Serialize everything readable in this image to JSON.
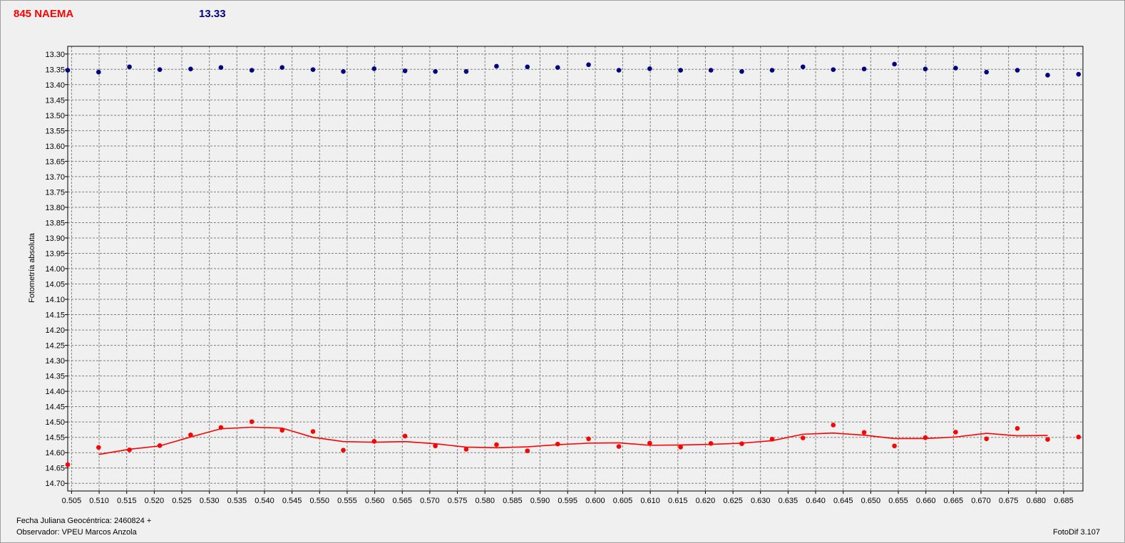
{
  "header": {
    "object_name": "845 NAEMA",
    "comparison_magnitude": "13.33"
  },
  "footer": {
    "date_label": "Fecha Juliana Geocéntrica: 2460824 +",
    "observer_label": "Observador: VPEU Marcos Anzola",
    "version_label": "FotoDif 3.107"
  },
  "colors": {
    "object": "#ff0000",
    "comparison": "#000080",
    "grid": "#808080"
  },
  "chart_data": {
    "type": "scatter",
    "ylabel": "Fotometría absoluta",
    "xlabel": "",
    "xlim": [
      0.5043,
      0.6885
    ],
    "ylim": [
      14.725,
      13.275
    ],
    "y_inverted": true,
    "grid": true,
    "x_ticks": [
      0.505,
      0.51,
      0.515,
      0.52,
      0.525,
      0.53,
      0.535,
      0.54,
      0.545,
      0.55,
      0.555,
      0.56,
      0.565,
      0.57,
      0.575,
      0.58,
      0.585,
      0.59,
      0.595,
      0.6,
      0.605,
      0.61,
      0.615,
      0.62,
      0.625,
      0.63,
      0.635,
      0.64,
      0.645,
      0.65,
      0.655,
      0.66,
      0.665,
      0.67,
      0.675,
      0.68,
      0.685
    ],
    "y_ticks": [
      13.3,
      13.35,
      13.4,
      13.45,
      13.5,
      13.55,
      13.6,
      13.65,
      13.7,
      13.75,
      13.8,
      13.85,
      13.9,
      13.95,
      14.0,
      14.05,
      14.1,
      14.15,
      14.2,
      14.25,
      14.3,
      14.35,
      14.4,
      14.45,
      14.5,
      14.55,
      14.6,
      14.65,
      14.7
    ],
    "x": [
      0.5043,
      0.5099,
      0.5155,
      0.521,
      0.5266,
      0.5321,
      0.5377,
      0.5432,
      0.5488,
      0.5543,
      0.5599,
      0.5655,
      0.571,
      0.5766,
      0.5821,
      0.5877,
      0.5932,
      0.5988,
      0.6043,
      0.6099,
      0.6155,
      0.621,
      0.6266,
      0.6321,
      0.6377,
      0.6432,
      0.6488,
      0.6543,
      0.6599,
      0.6654,
      0.671,
      0.6766,
      0.6821,
      0.6877
    ],
    "series": [
      {
        "marker": "dot",
        "color": "#000080",
        "values": [
          13.353,
          13.359,
          13.342,
          13.351,
          13.349,
          13.344,
          13.353,
          13.344,
          13.351,
          13.357,
          13.348,
          13.355,
          13.357,
          13.357,
          13.34,
          13.342,
          13.344,
          13.335,
          13.353,
          13.348,
          13.353,
          13.353,
          13.357,
          13.353,
          13.342,
          13.351,
          13.349,
          13.333,
          13.349,
          13.346,
          13.359,
          13.353,
          13.369,
          13.366
        ]
      },
      {
        "marker": "dot",
        "color": "#ff0000",
        "values": [
          14.639,
          14.583,
          14.591,
          14.577,
          14.542,
          14.518,
          14.499,
          14.527,
          14.531,
          14.592,
          14.563,
          14.546,
          14.578,
          14.589,
          14.574,
          14.594,
          14.572,
          14.555,
          14.58,
          14.569,
          14.582,
          14.57,
          14.571,
          14.556,
          14.552,
          14.51,
          14.534,
          14.578,
          14.551,
          14.533,
          14.555,
          14.521,
          14.557,
          14.549
        ]
      },
      {
        "marker": "line",
        "color": "#ff0000",
        "x": [
          0.5099,
          0.5155,
          0.521,
          0.5266,
          0.5321,
          0.5377,
          0.5432,
          0.5488,
          0.5543,
          0.5599,
          0.5655,
          0.571,
          0.5766,
          0.5821,
          0.5877,
          0.5932,
          0.5988,
          0.6043,
          0.6099,
          0.6155,
          0.621,
          0.6266,
          0.6321,
          0.6377,
          0.6432,
          0.6488,
          0.6543,
          0.6599,
          0.6654,
          0.671,
          0.6766,
          0.6821
        ],
        "values": [
          14.606,
          14.589,
          14.578,
          14.549,
          14.522,
          14.517,
          14.52,
          14.55,
          14.564,
          14.566,
          14.564,
          14.571,
          14.582,
          14.584,
          14.581,
          14.574,
          14.569,
          14.568,
          14.576,
          14.575,
          14.573,
          14.569,
          14.561,
          14.54,
          14.536,
          14.543,
          14.554,
          14.554,
          14.549,
          14.537,
          14.545,
          14.544
        ]
      }
    ]
  }
}
